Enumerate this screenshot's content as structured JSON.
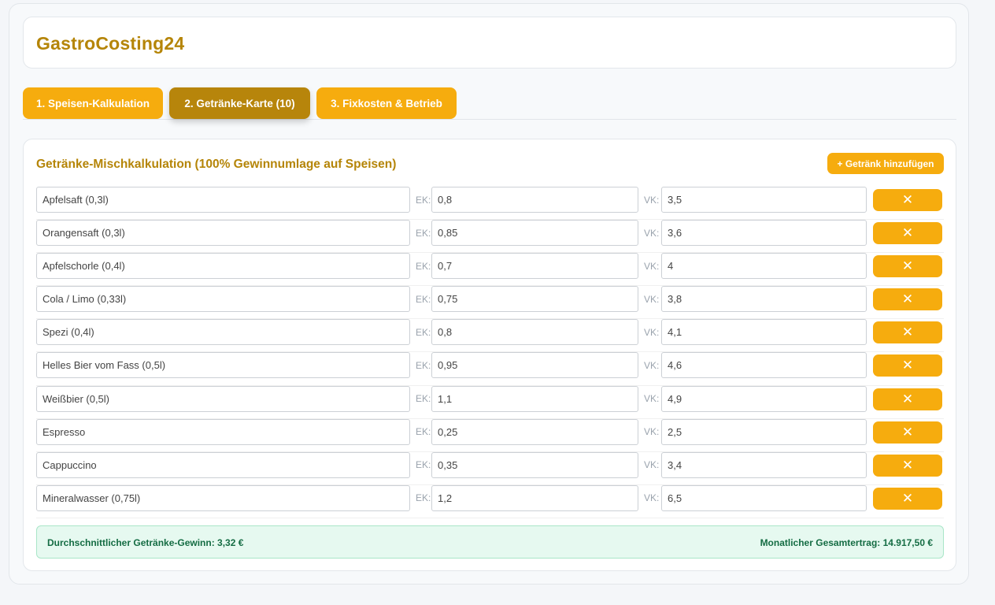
{
  "app": {
    "title": "GastroCosting24"
  },
  "tabs": [
    {
      "label": "1. Speisen-Kalkulation",
      "active": false
    },
    {
      "label": "2. Getränke-Karte (10)",
      "active": true
    },
    {
      "label": "3. Fixkosten & Betrieb",
      "active": false
    }
  ],
  "panel": {
    "title": "Getränke-Mischkalkulation (100% Gewinnumlage auf Speisen)",
    "add_button": "+ Getränk hinzufügen",
    "ek_label": "EK:",
    "vk_label": "VK:",
    "delete_icon": "close-icon"
  },
  "drinks": [
    {
      "name": "Apfelsaft (0,3l)",
      "ek": "0,8",
      "vk": "3,5"
    },
    {
      "name": "Orangensaft (0,3l)",
      "ek": "0,85",
      "vk": "3,6"
    },
    {
      "name": "Apfelschorle (0,4l)",
      "ek": "0,7",
      "vk": "4"
    },
    {
      "name": "Cola / Limo (0,33l)",
      "ek": "0,75",
      "vk": "3,8"
    },
    {
      "name": "Spezi (0,4l)",
      "ek": "0,8",
      "vk": "4,1"
    },
    {
      "name": "Helles Bier vom Fass (0,5l)",
      "ek": "0,95",
      "vk": "4,6"
    },
    {
      "name": "Weißbier (0,5l)",
      "ek": "1,1",
      "vk": "4,9"
    },
    {
      "name": "Espresso",
      "ek": "0,25",
      "vk": "2,5"
    },
    {
      "name": "Cappuccino",
      "ek": "0,35",
      "vk": "3,4"
    },
    {
      "name": "Mineralwasser (0,75l)",
      "ek": "1,2",
      "vk": "6,5"
    }
  ],
  "summary": {
    "avg_profit": "Durchschnittlicher Getränke-Gewinn: 3,32 €",
    "monthly_total": "Monatlicher Gesamtertrag: 14.917,50 €"
  },
  "colors": {
    "accent": "#f6ac0e",
    "accent_dark": "#b7850b",
    "title": "#b58508",
    "success_bg": "#e6f9f0",
    "success_text": "#146c43"
  }
}
